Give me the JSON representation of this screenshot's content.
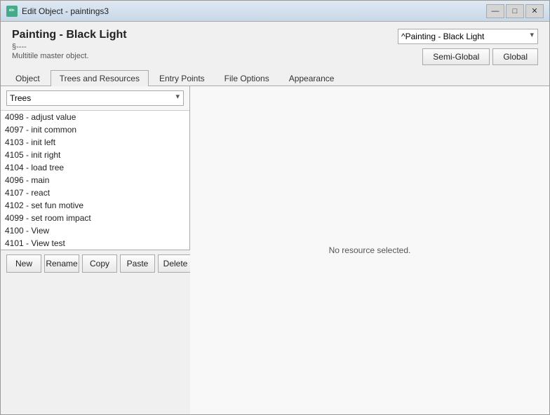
{
  "window": {
    "title": "Edit Object - paintings3",
    "icon": "edit-icon"
  },
  "header": {
    "object_name": "Painting - Black Light",
    "object_id": "§----",
    "object_type": "Multitile master object.",
    "dropdown_value": "^Painting - Black Light",
    "semi_global_label": "Semi-Global",
    "global_label": "Global"
  },
  "tabs": [
    {
      "id": "object",
      "label": "Object",
      "active": false
    },
    {
      "id": "trees-resources",
      "label": "Trees and Resources",
      "active": true
    },
    {
      "id": "entry-points",
      "label": "Entry Points",
      "active": false
    },
    {
      "id": "file-options",
      "label": "File Options",
      "active": false
    },
    {
      "id": "appearance",
      "label": "Appearance",
      "active": false
    }
  ],
  "left_panel": {
    "dropdown_label": "Trees",
    "tree_items": [
      {
        "id": 4098,
        "label": "4098 - adjust value"
      },
      {
        "id": 4097,
        "label": "4097 - init common"
      },
      {
        "id": 4103,
        "label": "4103 - init left"
      },
      {
        "id": 4105,
        "label": "4105 - init right"
      },
      {
        "id": 4104,
        "label": "4104 - load tree"
      },
      {
        "id": 4096,
        "label": "4096 - main"
      },
      {
        "id": 4107,
        "label": "4107 - react"
      },
      {
        "id": 4102,
        "label": "4102 - set fun motive"
      },
      {
        "id": 4099,
        "label": "4099 - set room impact"
      },
      {
        "id": 4100,
        "label": "4100 - View"
      },
      {
        "id": 4101,
        "label": "4101 - View test"
      }
    ]
  },
  "right_panel": {
    "empty_message": "No resource selected."
  },
  "toolbar": {
    "new_label": "New",
    "rename_label": "Rename",
    "copy_label": "Copy",
    "paste_label": "Paste",
    "delete_label": "Delete"
  },
  "title_controls": {
    "minimize": "—",
    "maximize": "□",
    "close": "✕"
  }
}
